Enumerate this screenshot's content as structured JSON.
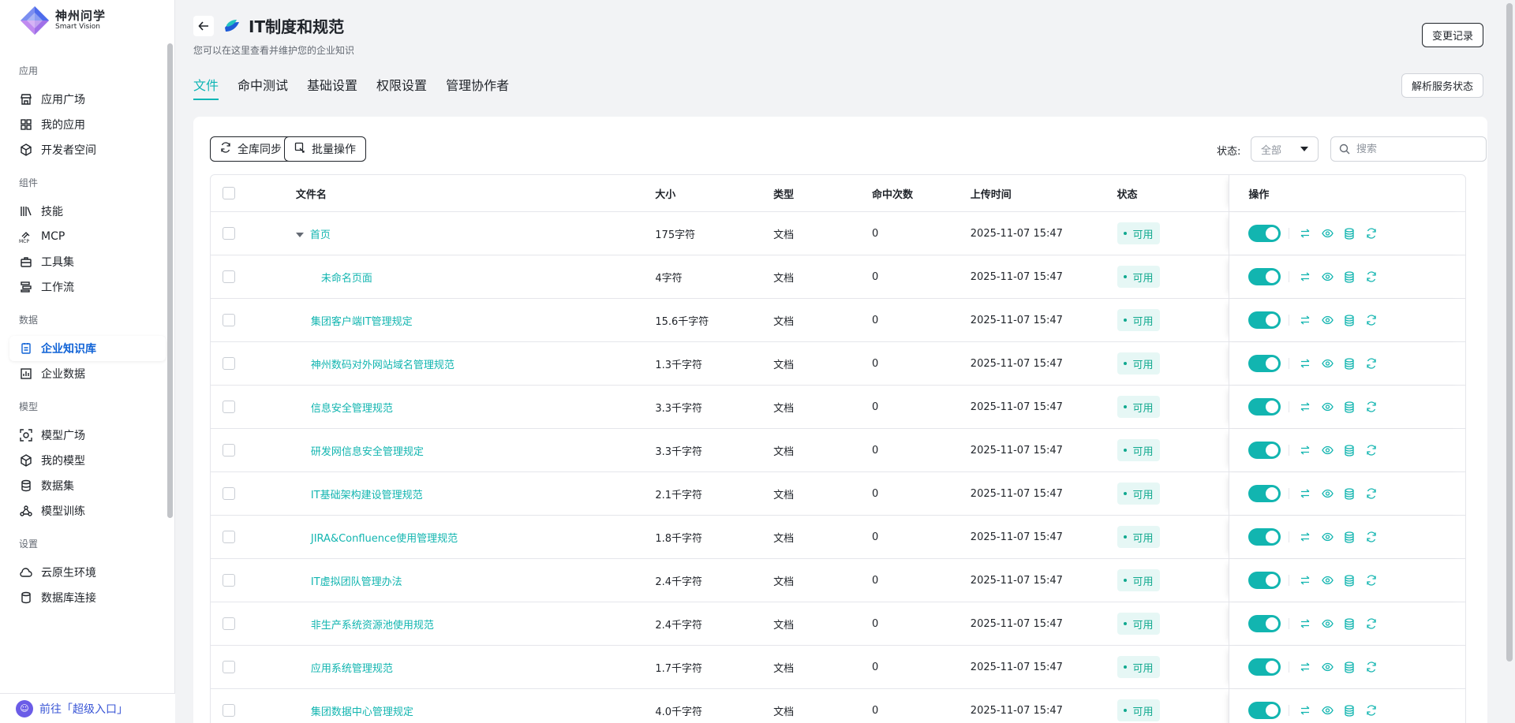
{
  "brand": {
    "name_cn": "神州问学",
    "name_en": "Smart Vision"
  },
  "sidebar": {
    "groups": [
      {
        "title": "应用",
        "items": [
          {
            "label": "应用广场",
            "icon": "store-icon"
          },
          {
            "label": "我的应用",
            "icon": "grid-icon"
          },
          {
            "label": "开发者空间",
            "icon": "cube-icon"
          }
        ]
      },
      {
        "title": "组件",
        "items": [
          {
            "label": "技能",
            "icon": "books-icon"
          },
          {
            "label": "MCP",
            "icon": "mcp-icon"
          },
          {
            "label": "工具集",
            "icon": "toolbox-icon"
          },
          {
            "label": "工作流",
            "icon": "workflow-icon"
          }
        ]
      },
      {
        "title": "数据",
        "items": [
          {
            "label": "企业知识库",
            "icon": "knowledge-icon",
            "active": true
          },
          {
            "label": "企业数据",
            "icon": "chart-icon"
          }
        ]
      },
      {
        "title": "模型",
        "items": [
          {
            "label": "模型广场",
            "icon": "model-scan-icon"
          },
          {
            "label": "我的模型",
            "icon": "box-icon"
          },
          {
            "label": "数据集",
            "icon": "database-icon"
          },
          {
            "label": "模型训练",
            "icon": "training-icon"
          }
        ]
      },
      {
        "title": "设置",
        "items": [
          {
            "label": "云原生环境",
            "icon": "cloud-icon"
          },
          {
            "label": "数据库连接",
            "icon": "db-link-icon"
          }
        ]
      }
    ],
    "footer_label": "前往「超级入口」"
  },
  "header": {
    "title": "IT制度和规范",
    "subtitle": "您可以在这里查看并维护您的企业知识",
    "changes_button": "变更记录",
    "parse_button": "解析服务状态"
  },
  "tabs": [
    {
      "label": "文件",
      "active": true
    },
    {
      "label": "命中测试"
    },
    {
      "label": "基础设置"
    },
    {
      "label": "权限设置"
    },
    {
      "label": "管理协作者"
    }
  ],
  "toolbar": {
    "sync_button": "全库同步",
    "batch_button": "批量操作",
    "status_label": "状态:",
    "status_value": "全部",
    "search_placeholder": "搜索"
  },
  "table": {
    "columns": {
      "name": "文件名",
      "size": "大小",
      "type": "类型",
      "hits": "命中次数",
      "time": "上传时间",
      "status": "状态",
      "ops": "操作"
    },
    "rows": [
      {
        "name": "首页",
        "size": "175字符",
        "type": "文档",
        "hits": "0",
        "time": "2025-11-07 15:47",
        "status": "可用",
        "level": 0,
        "expanded": true
      },
      {
        "name": "未命名页面",
        "size": "4字符",
        "type": "文档",
        "hits": "0",
        "time": "2025-11-07 15:47",
        "status": "可用",
        "level": 2
      },
      {
        "name": "集团客户端IT管理规定",
        "size": "15.6千字符",
        "type": "文档",
        "hits": "0",
        "time": "2025-11-07 15:47",
        "status": "可用",
        "level": 1
      },
      {
        "name": "神州数码对外网站域名管理规范",
        "size": "1.3千字符",
        "type": "文档",
        "hits": "0",
        "time": "2025-11-07 15:47",
        "status": "可用",
        "level": 1
      },
      {
        "name": "信息安全管理规范",
        "size": "3.3千字符",
        "type": "文档",
        "hits": "0",
        "time": "2025-11-07 15:47",
        "status": "可用",
        "level": 1
      },
      {
        "name": "研发网信息安全管理规定",
        "size": "3.3千字符",
        "type": "文档",
        "hits": "0",
        "time": "2025-11-07 15:47",
        "status": "可用",
        "level": 1
      },
      {
        "name": "IT基础架构建设管理规范",
        "size": "2.1千字符",
        "type": "文档",
        "hits": "0",
        "time": "2025-11-07 15:47",
        "status": "可用",
        "level": 1
      },
      {
        "name": "JIRA&Confluence使用管理规范",
        "size": "1.8千字符",
        "type": "文档",
        "hits": "0",
        "time": "2025-11-07 15:47",
        "status": "可用",
        "level": 1
      },
      {
        "name": "IT虚拟团队管理办法",
        "size": "2.4千字符",
        "type": "文档",
        "hits": "0",
        "time": "2025-11-07 15:47",
        "status": "可用",
        "level": 1
      },
      {
        "name": "非生产系统资源池使用规范",
        "size": "2.4千字符",
        "type": "文档",
        "hits": "0",
        "time": "2025-11-07 15:47",
        "status": "可用",
        "level": 1
      },
      {
        "name": "应用系统管理规范",
        "size": "1.7千字符",
        "type": "文档",
        "hits": "0",
        "time": "2025-11-07 15:47",
        "status": "可用",
        "level": 1
      },
      {
        "name": "集团数据中心管理规定",
        "size": "4.0千字符",
        "type": "文档",
        "hits": "0",
        "time": "2025-11-07 15:47",
        "status": "可用",
        "level": 1
      }
    ]
  },
  "colors": {
    "accent": "#12b5b0",
    "active_nav": "#0f62d6",
    "status_bg": "#e6f7f5"
  }
}
